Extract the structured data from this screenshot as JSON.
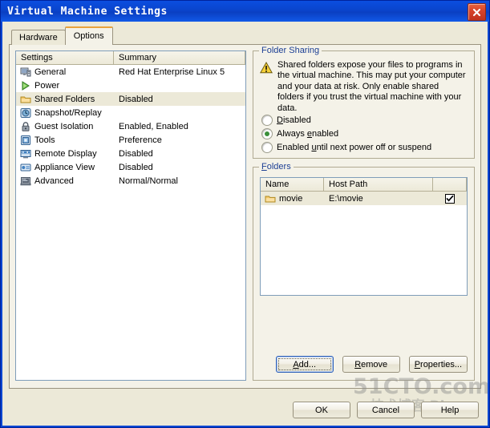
{
  "window": {
    "title": "Virtual Machine Settings",
    "close_icon": "close-icon"
  },
  "tabs": [
    {
      "label": "Hardware",
      "active": false
    },
    {
      "label": "Options",
      "active": true
    }
  ],
  "settings_list": {
    "columns": [
      "Settings",
      "Summary"
    ],
    "rows": [
      {
        "icon": "general-monitor-icon",
        "label": "General",
        "summary": "Red Hat Enterprise Linux 5",
        "selected": false
      },
      {
        "icon": "power-play-icon",
        "label": "Power",
        "summary": "",
        "selected": false
      },
      {
        "icon": "shared-folders-icon",
        "label": "Shared Folders",
        "summary": "Disabled",
        "selected": true
      },
      {
        "icon": "snapshot-replay-icon",
        "label": "Snapshot/Replay",
        "summary": "",
        "selected": false
      },
      {
        "icon": "guest-isolation-lock-icon",
        "label": "Guest Isolation",
        "summary": "Enabled, Enabled",
        "selected": false
      },
      {
        "icon": "tools-icon",
        "label": "Tools",
        "summary": "Preference",
        "selected": false
      },
      {
        "icon": "remote-display-icon",
        "label": "Remote Display",
        "summary": "Disabled",
        "selected": false
      },
      {
        "icon": "appliance-view-icon",
        "label": "Appliance View",
        "summary": "Disabled",
        "selected": false
      },
      {
        "icon": "advanced-icon",
        "label": "Advanced",
        "summary": "Normal/Normal",
        "selected": false
      }
    ]
  },
  "folder_sharing": {
    "legend": "Folder Sharing",
    "warning_icon": "warning-triangle-icon",
    "warning_text": "Shared folders expose your files to programs in the virtual machine. This may put your computer and your data at risk. Only enable shared folders if you trust the virtual machine with your data.",
    "options": [
      {
        "label_pre": "",
        "accel": "D",
        "label_post": "isabled",
        "selected": false
      },
      {
        "label_pre": "Always ",
        "accel": "e",
        "label_post": "nabled",
        "selected": true
      },
      {
        "label_pre": "Enabled ",
        "accel": "u",
        "label_post": "ntil next power off or suspend",
        "selected": false
      }
    ]
  },
  "folders": {
    "legend": "Folders",
    "columns": [
      "Name",
      "Host Path",
      ""
    ],
    "rows": [
      {
        "icon": "folder-icon",
        "name": "movie",
        "host_path": "E:\\movie",
        "enabled": true
      }
    ],
    "buttons": [
      {
        "pre": "",
        "accel": "A",
        "post": "dd...",
        "focused": true
      },
      {
        "pre": "",
        "accel": "R",
        "post": "emove",
        "focused": false
      },
      {
        "pre": "",
        "accel": "P",
        "post": "roperties...",
        "focused": false
      }
    ]
  },
  "dialog_buttons": [
    {
      "label": "OK"
    },
    {
      "label": "Cancel"
    },
    {
      "label": "Help"
    }
  ],
  "watermark": {
    "main": "51CTO.com",
    "sub": "技术博客 Blog"
  },
  "colors": {
    "titlebar": "#0a44cc",
    "close_button": "#c0331f",
    "dialog_face": "#ece9d8",
    "tab_page": "#f4f2e8",
    "active_tab_accent": "#e8a33d",
    "group_legend": "#1c3f94",
    "selection": "#ece9d8",
    "radio_dot": "#3a8f3a"
  }
}
